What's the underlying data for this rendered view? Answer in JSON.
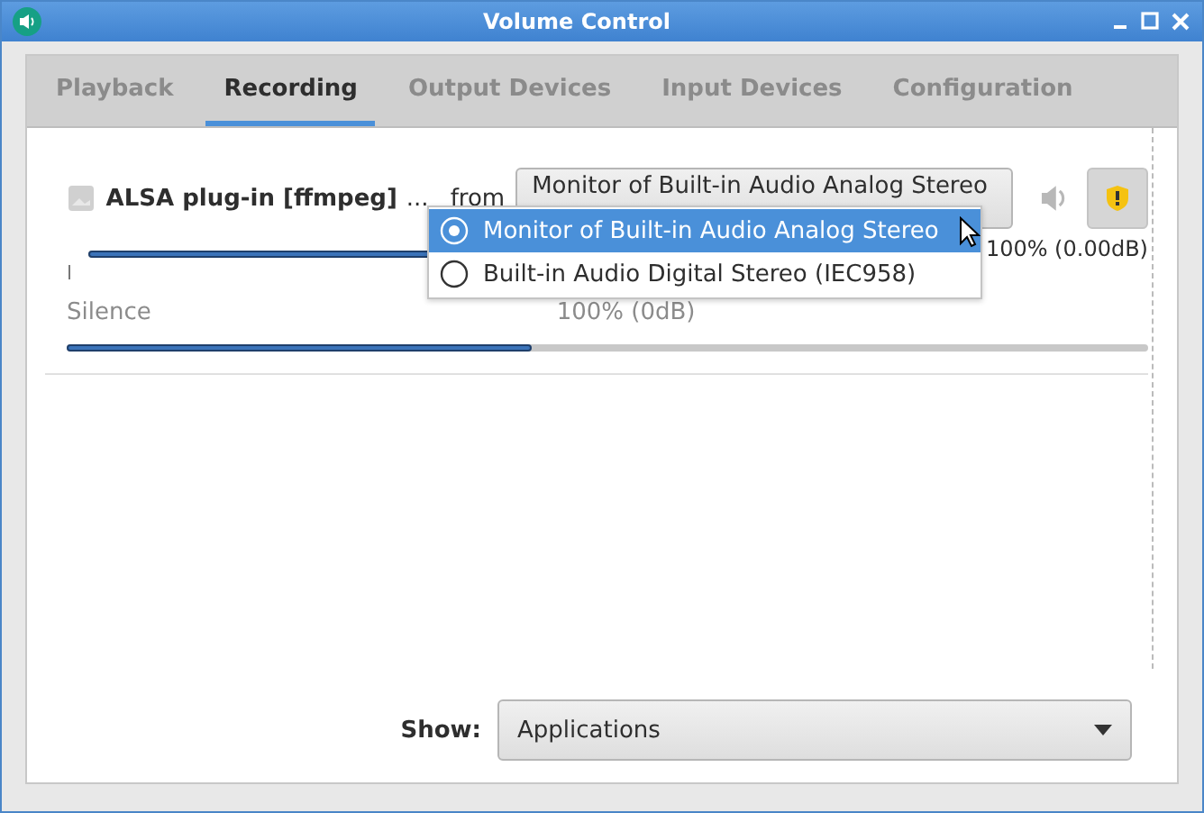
{
  "window": {
    "title": "Volume Control"
  },
  "tabs": [
    {
      "label": "Playback",
      "selected": false
    },
    {
      "label": "Recording",
      "selected": true
    },
    {
      "label": "Output Devices",
      "selected": false
    },
    {
      "label": "Input Devices",
      "selected": false
    },
    {
      "label": "Configuration",
      "selected": false
    }
  ],
  "streams": [
    {
      "name": "ALSA plug-in [ffmpeg]",
      "ellipsis": "...",
      "from_label": "from",
      "source": "Monitor of Built-in Audio Analog Stereo",
      "muted": false,
      "locked": true,
      "level": 1,
      "reading": "100% (0.00dB)",
      "scale_labels": [
        "Silence",
        "100% (0dB)"
      ],
      "meter": {
        "level": 0.43
      }
    }
  ],
  "source_menu": {
    "options": [
      {
        "label": "Monitor of Built-in Audio Analog Stereo",
        "selected": true
      },
      {
        "label": "Built-in Audio Digital Stereo (IEC958)",
        "selected": false
      }
    ]
  },
  "show": {
    "label": "Show:",
    "value": "Applications"
  }
}
